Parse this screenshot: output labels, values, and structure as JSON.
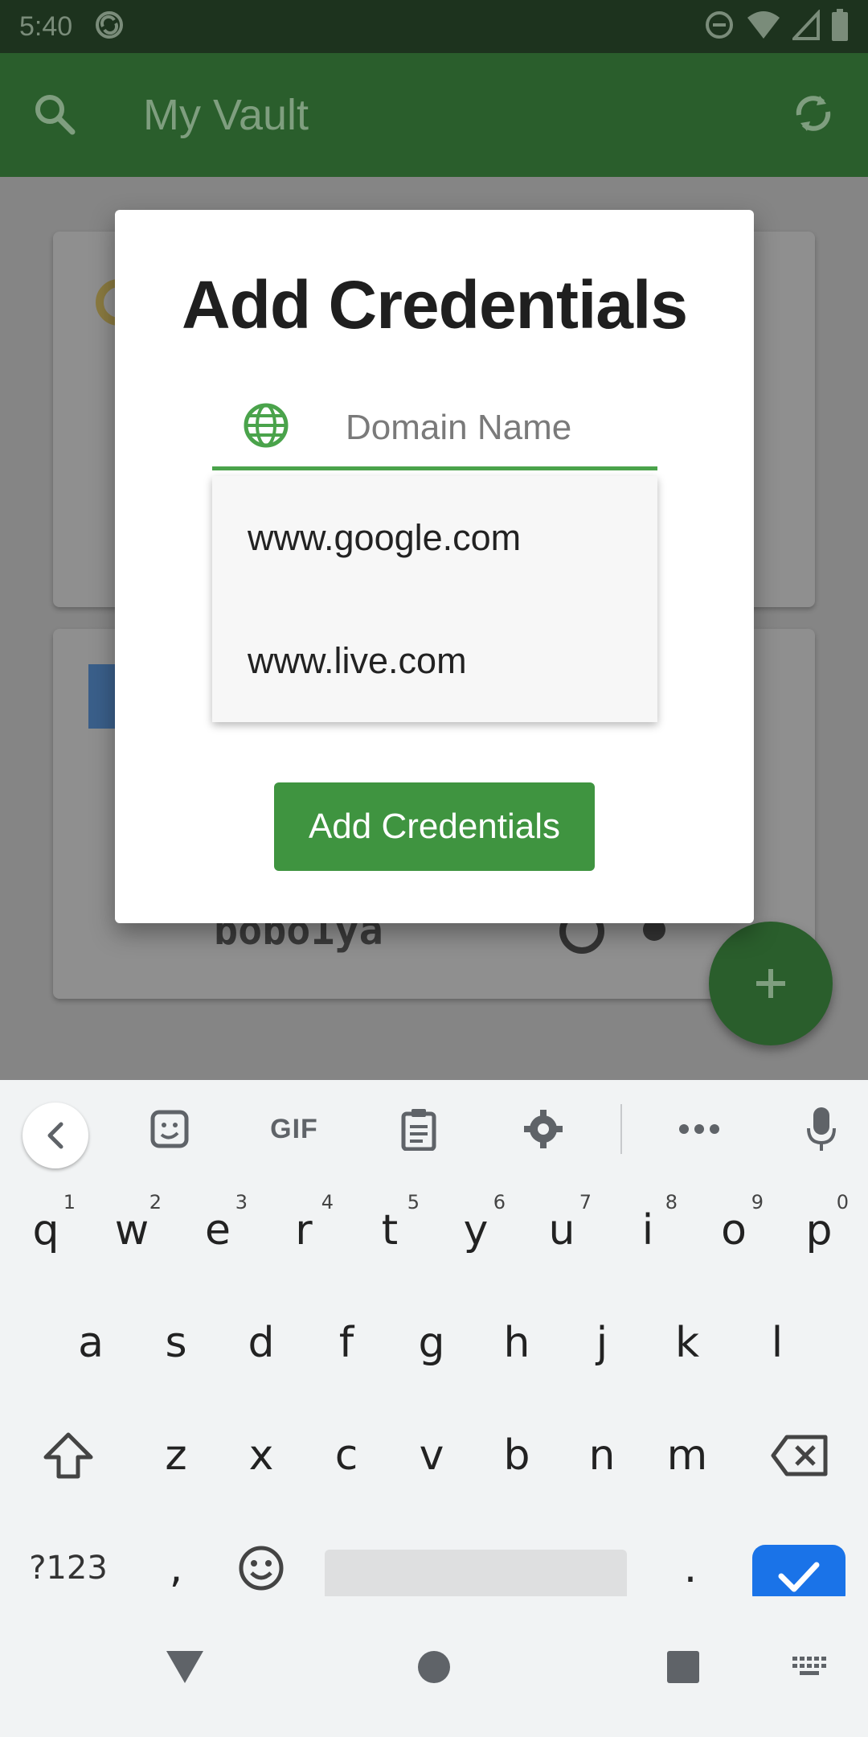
{
  "status_bar": {
    "time": "5:40"
  },
  "app_bar": {
    "title": "My Vault"
  },
  "background_list": {
    "username_visible": "bobo1ya"
  },
  "dialog": {
    "title": "Add Credentials",
    "domain_placeholder": "Domain Name",
    "suggestions": [
      "www.google.com",
      "www.live.com"
    ],
    "submit_label": "Add Credentials"
  },
  "keyboard": {
    "toolbar": {
      "gif_label": "GIF"
    },
    "row1": [
      {
        "key": "q",
        "hint": "1"
      },
      {
        "key": "w",
        "hint": "2"
      },
      {
        "key": "e",
        "hint": "3"
      },
      {
        "key": "r",
        "hint": "4"
      },
      {
        "key": "t",
        "hint": "5"
      },
      {
        "key": "y",
        "hint": "6"
      },
      {
        "key": "u",
        "hint": "7"
      },
      {
        "key": "i",
        "hint": "8"
      },
      {
        "key": "o",
        "hint": "9"
      },
      {
        "key": "p",
        "hint": "0"
      }
    ],
    "row2": [
      "a",
      "s",
      "d",
      "f",
      "g",
      "h",
      "j",
      "k",
      "l"
    ],
    "row3": [
      "z",
      "x",
      "c",
      "v",
      "b",
      "n",
      "m"
    ],
    "row4": {
      "symbols_label": "?123",
      "comma": ",",
      "period": "."
    }
  },
  "colors": {
    "status_bar": "#1d331e",
    "app_bar": "#2a5e2c",
    "accent_green": "#3f9440",
    "underline_green": "#4aa34b",
    "enter_blue": "#1a73e8"
  },
  "icons": {
    "status": [
      "do-not-disturb-icon",
      "wifi-icon",
      "signal-icon",
      "battery-icon",
      "sync-status-icon"
    ],
    "app_bar": [
      "search-icon",
      "sync-icon"
    ],
    "dialog": [
      "globe-icon"
    ],
    "keyboard_toolbar": [
      "back-chevron-icon",
      "sticker-icon",
      "clipboard-icon",
      "settings-icon",
      "more-icon",
      "mic-icon"
    ],
    "keyboard": [
      "shift-icon",
      "backspace-icon",
      "emoji-icon",
      "check-icon"
    ],
    "nav": [
      "back-triangle-icon",
      "home-circle-icon",
      "recents-square-icon",
      "keyboard-switch-icon"
    ]
  }
}
